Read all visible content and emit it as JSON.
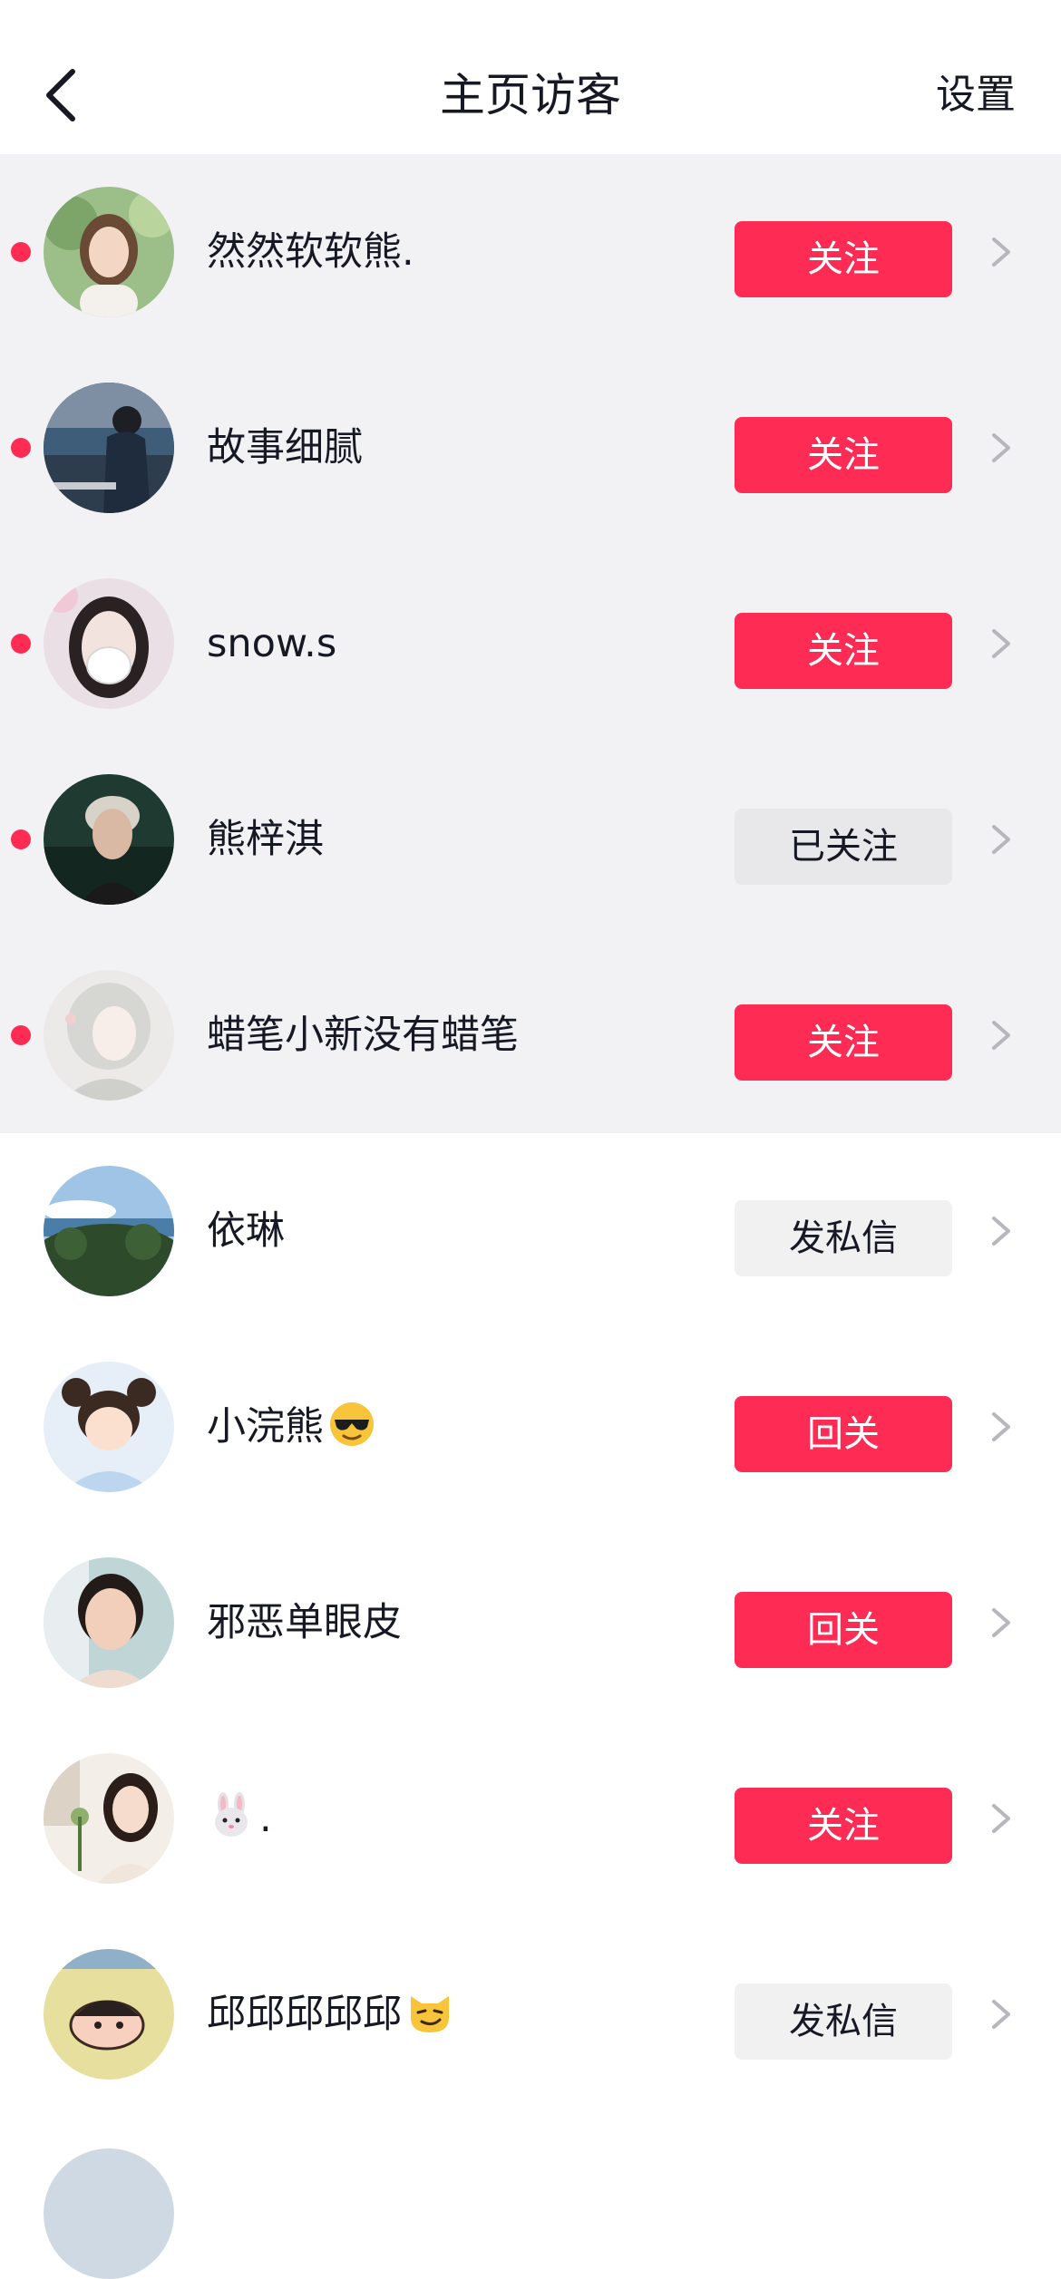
{
  "header": {
    "title": "主页访客",
    "settings_label": "设置"
  },
  "icons": {
    "back": "chevron-left-icon",
    "row_arrow": "chevron-right-icon",
    "unread": "red-dot-icon"
  },
  "colors": {
    "accent": "#fe2c55",
    "new_visitor_bg": "#f2f2f5",
    "muted_button": "#e8e8ea"
  },
  "visitors": [
    {
      "name": "然然软软熊.",
      "action": "关注",
      "is_new": true
    },
    {
      "name": "故事细腻",
      "action": "关注",
      "is_new": true
    },
    {
      "name": "snow.s",
      "action": "关注",
      "is_new": true
    },
    {
      "name": "熊梓淇",
      "action": "已关注",
      "is_new": true
    },
    {
      "name": "蜡笔小新没有蜡笔",
      "action": "关注",
      "is_new": true
    },
    {
      "name": "依琳",
      "action": "发私信",
      "is_new": false
    },
    {
      "name": "小浣熊",
      "emoji": "sunglasses-face-emoji",
      "action": "回关",
      "is_new": false
    },
    {
      "name": "邪恶单眼皮",
      "action": "回关",
      "is_new": false
    },
    {
      "name": "",
      "emoji": "rabbit-face-emoji",
      "name_suffix": ".",
      "action": "关注",
      "is_new": false
    },
    {
      "name": "邱邱邱邱邱",
      "emoji": "smirking-cat-emoji",
      "action": "发私信",
      "is_new": false
    }
  ]
}
